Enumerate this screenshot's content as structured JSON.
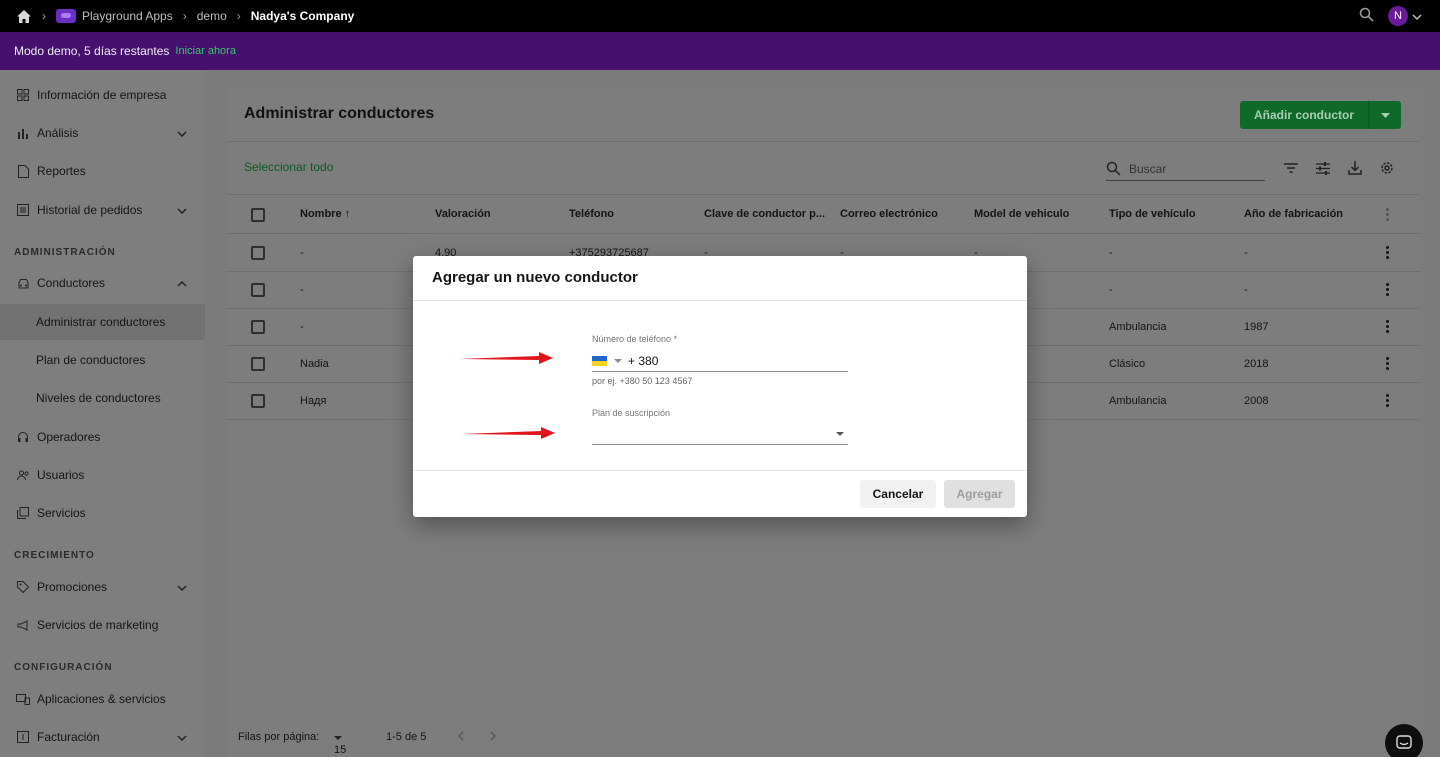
{
  "topbar": {
    "breadcrumbs": [
      "Playground Apps",
      "demo",
      "Nadya's Company"
    ],
    "avatar_letter": "N"
  },
  "banner": {
    "text": "Modo demo, 5 días restantes",
    "cta": "Iniciar ahora"
  },
  "sidebar": {
    "items": [
      {
        "label": "Información de empresa",
        "icon": "dashboard-icon"
      },
      {
        "label": "Análisis",
        "icon": "bar-chart-icon"
      },
      {
        "label": "Reportes",
        "icon": "document-icon"
      },
      {
        "label": "Historial de pedidos",
        "icon": "list-icon"
      },
      {
        "label": "Conductores",
        "icon": "car-icon"
      },
      {
        "label": "Administrar conductores"
      },
      {
        "label": "Plan de conductores"
      },
      {
        "label": "Niveles de conductores"
      },
      {
        "label": "Operadores",
        "icon": "headset-icon"
      },
      {
        "label": "Usuarios",
        "icon": "users-icon"
      },
      {
        "label": "Servicios",
        "icon": "services-icon"
      },
      {
        "label": "Promociones",
        "icon": "tag-icon"
      },
      {
        "label": "Servicios de marketing",
        "icon": "megaphone-icon"
      },
      {
        "label": "Aplicaciones & servicios",
        "icon": "devices-icon"
      },
      {
        "label": "Facturación",
        "icon": "billing-icon"
      }
    ],
    "sections": [
      "ADMINISTRACIÓN",
      "CRECIMIENTO",
      "CONFIGURACIÓN"
    ]
  },
  "main": {
    "title": "Administrar conductores",
    "add_button": "Añadir conductor",
    "select_all": "Seleccionar todo",
    "search_placeholder": "Buscar",
    "columns": [
      "Nombre",
      "Valoración",
      "Teléfono",
      "Clave de conductor p...",
      "Correo electrónico",
      "Model de vehiculo",
      "Tipo de vehículo",
      "Año de fabricación"
    ],
    "rows": [
      {
        "name": "-",
        "rating": "4.90",
        "phone": "+375293725687",
        "key": "-",
        "email": "-",
        "model": "-",
        "type": "-",
        "year": "-"
      },
      {
        "name": "-",
        "type": "-",
        "year": "-"
      },
      {
        "name": "-",
        "type": "Ambulancia",
        "year": "1987"
      },
      {
        "name": "Nadia",
        "type": "Clásico",
        "year": "2018"
      },
      {
        "name": "Надя",
        "type": "Ambulancia",
        "year": "2008"
      }
    ],
    "footer": {
      "rows_per_page_label": "Filas por página:",
      "rows_per_page": "15",
      "range": "1-5 de 5"
    }
  },
  "modal": {
    "title": "Agregar un nuevo conductor",
    "phone_label": "Número de teléfono *",
    "phone_value": "+ 380",
    "phone_hint": "por ej. +380 50 123 4567",
    "plan_label": "Plan de suscripción",
    "cancel": "Cancelar",
    "add": "Agregar"
  },
  "colors": {
    "accent_green": "#1aa447",
    "banner_purple": "#6a18a6",
    "annotation_red": "#e0141a"
  }
}
